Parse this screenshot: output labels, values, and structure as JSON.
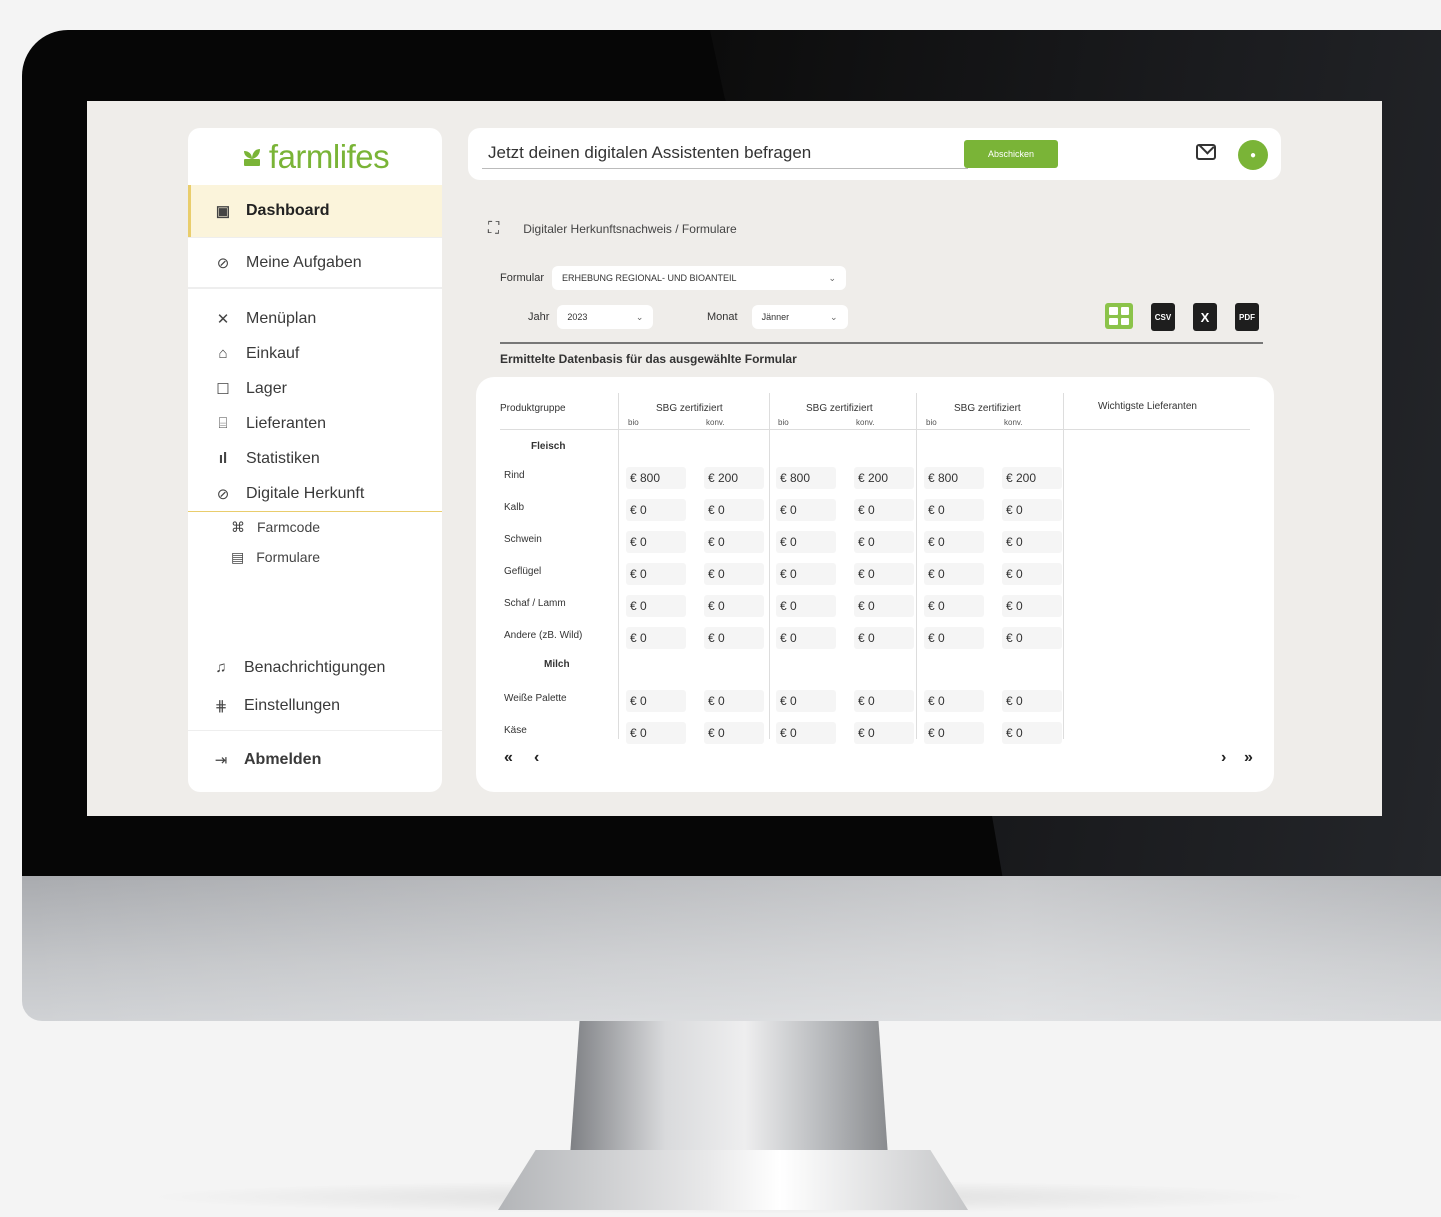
{
  "brand": {
    "name": "farmlifes",
    "accent": "#7ab437",
    "highlight": "#fbf4db"
  },
  "sidebar": {
    "items": [
      {
        "label": "Dashboard",
        "icon": "layout-icon"
      },
      {
        "label": "Meine Aufgaben",
        "icon": "check-circle-icon"
      },
      {
        "label": "Menüplan",
        "icon": "cutlery-icon"
      },
      {
        "label": "Einkauf",
        "icon": "basket-icon"
      },
      {
        "label": "Lager",
        "icon": "archive-icon"
      },
      {
        "label": "Lieferanten",
        "icon": "store-icon"
      },
      {
        "label": "Statistiken",
        "icon": "bar-chart-icon"
      },
      {
        "label": "Digitale Herkunft",
        "icon": "check-circle-icon"
      }
    ],
    "subitems": [
      {
        "label": "Farmcode",
        "icon": "scan-icon"
      },
      {
        "label": "Formulare",
        "icon": "document-icon"
      }
    ],
    "bottom": [
      {
        "label": "Benachrichtigungen",
        "icon": "bell-icon"
      },
      {
        "label": "Einstellungen",
        "icon": "sliders-icon"
      },
      {
        "label": "Abmelden",
        "icon": "logout-icon"
      }
    ]
  },
  "topbar": {
    "assistant_text": "Jetzt deinen digitalen Assistenten befragen",
    "send_label": "Abschicken"
  },
  "breadcrumb": "Digitaler Herkunftsnachweis / Formulare",
  "filters": {
    "formular_label": "Formular",
    "formular_value": "ERHEBUNG REGIONAL- UND BIOANTEIL",
    "jahr_label": "Jahr",
    "jahr_value": "2023",
    "monat_label": "Monat",
    "monat_value": "Jänner"
  },
  "exports": [
    "CSV",
    "X",
    "PDF"
  ],
  "section_title": "Ermittelte Datenbasis für das ausgewählte Formular",
  "table": {
    "col_group": "Produktgruppe",
    "group_header": "SBG zertifiziert",
    "sub_bio": "bio",
    "sub_konv": "konv.",
    "suppliers_header": "Wichtigste Lieferanten",
    "group_fleisch": "Fleisch",
    "group_milch": "Milch",
    "rows": [
      {
        "name": "Rind",
        "values": [
          "€ 800",
          "€ 200",
          "€ 800",
          "€ 200",
          "€ 800",
          "€ 200"
        ]
      },
      {
        "name": "Kalb",
        "values": [
          "€ 0",
          "€ 0",
          "€ 0",
          "€ 0",
          "€ 0",
          "€ 0"
        ]
      },
      {
        "name": "Schwein",
        "values": [
          "€ 0",
          "€ 0",
          "€ 0",
          "€ 0",
          "€ 0",
          "€ 0"
        ]
      },
      {
        "name": "Geflügel",
        "values": [
          "€ 0",
          "€ 0",
          "€ 0",
          "€ 0",
          "€ 0",
          "€ 0"
        ]
      },
      {
        "name": "Schaf / Lamm",
        "values": [
          "€ 0",
          "€ 0",
          "€ 0",
          "€ 0",
          "€ 0",
          "€ 0"
        ]
      },
      {
        "name": "Andere (zB. Wild)",
        "values": [
          "€ 0",
          "€ 0",
          "€ 0",
          "€ 0",
          "€ 0",
          "€ 0"
        ]
      },
      {
        "name": "Weiße Palette",
        "values": [
          "€ 0",
          "€ 0",
          "€ 0",
          "€ 0",
          "€ 0",
          "€ 0"
        ]
      },
      {
        "name": "Käse",
        "values": [
          "€ 0",
          "€ 0",
          "€ 0",
          "€ 0",
          "€ 0",
          "€ 0"
        ]
      }
    ]
  },
  "pager": {
    "first": "«",
    "prev": "‹",
    "next": "›",
    "last": "»"
  }
}
